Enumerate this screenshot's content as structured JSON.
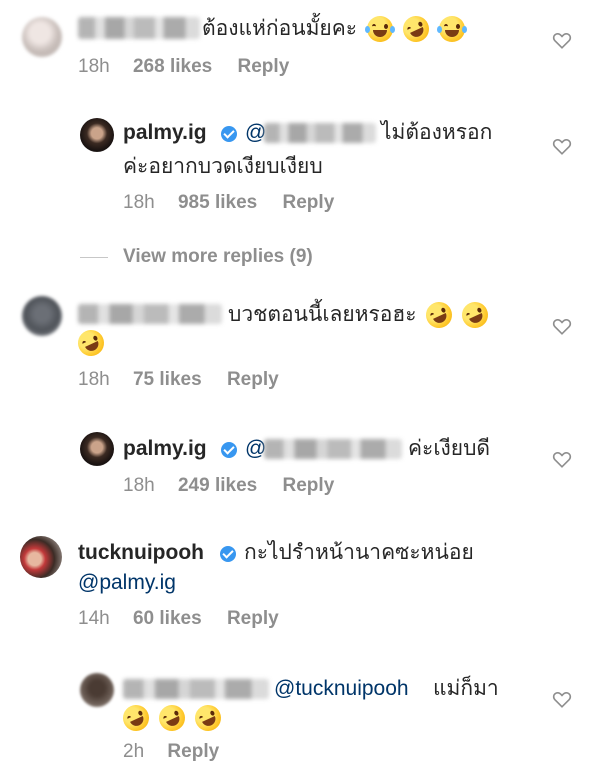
{
  "comments": [
    {
      "username_redacted": true,
      "text": "ต้องแห่ก่อนมั้ยคะ",
      "emojis": [
        "face-with-tears-of-joy",
        "rolling-on-the-floor-laughing",
        "face-with-tears-of-joy"
      ],
      "time": "18h",
      "likes": "268 likes",
      "reply_label": "Reply"
    },
    {
      "username": "palmy.ig",
      "verified": true,
      "mention_prefix": "@",
      "mention_redacted": true,
      "text_line1": "ไม่ต้องหรอก",
      "text_line2": "ค่ะอยากบวดเงียบเงียบ",
      "time": "18h",
      "likes": "985 likes",
      "reply_label": "Reply"
    },
    {
      "view_more": "View more replies (9)"
    },
    {
      "username_redacted": true,
      "text": "บวชตอนนี้เลยหรอฮะ",
      "emojis": [
        "rolling-on-the-floor-laughing",
        "rolling-on-the-floor-laughing",
        "rolling-on-the-floor-laughing"
      ],
      "time": "18h",
      "likes": "75 likes",
      "reply_label": "Reply"
    },
    {
      "username": "palmy.ig",
      "verified": true,
      "mention_prefix": "@",
      "mention_redacted": true,
      "text": "ค่ะเงียบดี",
      "time": "18h",
      "likes": "249 likes",
      "reply_label": "Reply"
    },
    {
      "username": "tucknuipooh",
      "verified": true,
      "text": "กะไปรำหน้านาคซะหน่อย",
      "mention": "@palmy.ig",
      "time": "14h",
      "likes": "60 likes",
      "reply_label": "Reply"
    },
    {
      "username_redacted": true,
      "mention": "@tucknuipooh",
      "text": "แม่ก็มา",
      "emojis": [
        "rolling-on-the-floor-laughing",
        "rolling-on-the-floor-laughing",
        "rolling-on-the-floor-laughing"
      ],
      "time": "2h",
      "reply_label": "Reply"
    }
  ],
  "icons": {
    "like": "heart-outline-icon",
    "verified": "verified-badge-icon"
  },
  "colors": {
    "text": "#262626",
    "meta": "#8e8e8e",
    "mention": "#003569",
    "verified": "#3897f0"
  }
}
